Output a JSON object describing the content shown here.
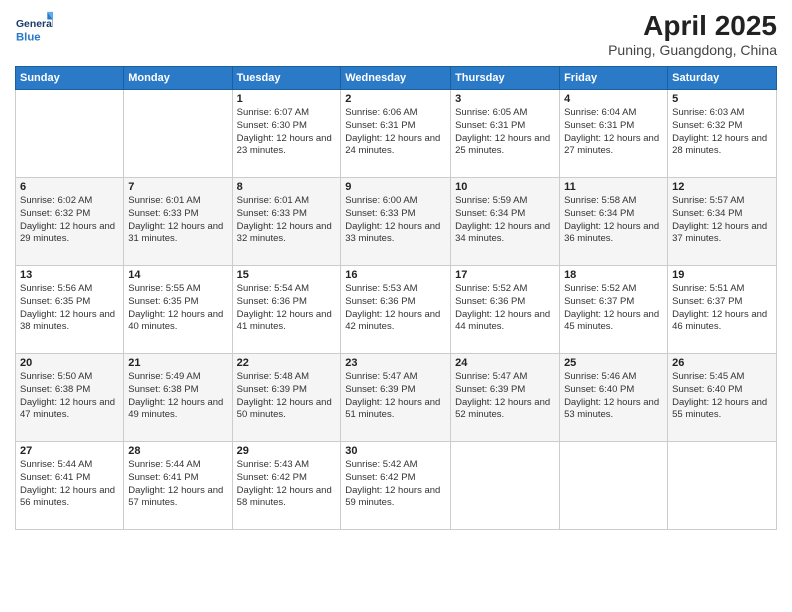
{
  "header": {
    "logo_general": "General",
    "logo_blue": "Blue",
    "title": "April 2025",
    "subtitle": "Puning, Guangdong, China"
  },
  "days_of_week": [
    "Sunday",
    "Monday",
    "Tuesday",
    "Wednesday",
    "Thursday",
    "Friday",
    "Saturday"
  ],
  "weeks": [
    [
      {
        "day": "",
        "info": ""
      },
      {
        "day": "",
        "info": ""
      },
      {
        "day": "1",
        "info": "Sunrise: 6:07 AM\nSunset: 6:30 PM\nDaylight: 12 hours and 23 minutes."
      },
      {
        "day": "2",
        "info": "Sunrise: 6:06 AM\nSunset: 6:31 PM\nDaylight: 12 hours and 24 minutes."
      },
      {
        "day": "3",
        "info": "Sunrise: 6:05 AM\nSunset: 6:31 PM\nDaylight: 12 hours and 25 minutes."
      },
      {
        "day": "4",
        "info": "Sunrise: 6:04 AM\nSunset: 6:31 PM\nDaylight: 12 hours and 27 minutes."
      },
      {
        "day": "5",
        "info": "Sunrise: 6:03 AM\nSunset: 6:32 PM\nDaylight: 12 hours and 28 minutes."
      }
    ],
    [
      {
        "day": "6",
        "info": "Sunrise: 6:02 AM\nSunset: 6:32 PM\nDaylight: 12 hours and 29 minutes."
      },
      {
        "day": "7",
        "info": "Sunrise: 6:01 AM\nSunset: 6:33 PM\nDaylight: 12 hours and 31 minutes."
      },
      {
        "day": "8",
        "info": "Sunrise: 6:01 AM\nSunset: 6:33 PM\nDaylight: 12 hours and 32 minutes."
      },
      {
        "day": "9",
        "info": "Sunrise: 6:00 AM\nSunset: 6:33 PM\nDaylight: 12 hours and 33 minutes."
      },
      {
        "day": "10",
        "info": "Sunrise: 5:59 AM\nSunset: 6:34 PM\nDaylight: 12 hours and 34 minutes."
      },
      {
        "day": "11",
        "info": "Sunrise: 5:58 AM\nSunset: 6:34 PM\nDaylight: 12 hours and 36 minutes."
      },
      {
        "day": "12",
        "info": "Sunrise: 5:57 AM\nSunset: 6:34 PM\nDaylight: 12 hours and 37 minutes."
      }
    ],
    [
      {
        "day": "13",
        "info": "Sunrise: 5:56 AM\nSunset: 6:35 PM\nDaylight: 12 hours and 38 minutes."
      },
      {
        "day": "14",
        "info": "Sunrise: 5:55 AM\nSunset: 6:35 PM\nDaylight: 12 hours and 40 minutes."
      },
      {
        "day": "15",
        "info": "Sunrise: 5:54 AM\nSunset: 6:36 PM\nDaylight: 12 hours and 41 minutes."
      },
      {
        "day": "16",
        "info": "Sunrise: 5:53 AM\nSunset: 6:36 PM\nDaylight: 12 hours and 42 minutes."
      },
      {
        "day": "17",
        "info": "Sunrise: 5:52 AM\nSunset: 6:36 PM\nDaylight: 12 hours and 44 minutes."
      },
      {
        "day": "18",
        "info": "Sunrise: 5:52 AM\nSunset: 6:37 PM\nDaylight: 12 hours and 45 minutes."
      },
      {
        "day": "19",
        "info": "Sunrise: 5:51 AM\nSunset: 6:37 PM\nDaylight: 12 hours and 46 minutes."
      }
    ],
    [
      {
        "day": "20",
        "info": "Sunrise: 5:50 AM\nSunset: 6:38 PM\nDaylight: 12 hours and 47 minutes."
      },
      {
        "day": "21",
        "info": "Sunrise: 5:49 AM\nSunset: 6:38 PM\nDaylight: 12 hours and 49 minutes."
      },
      {
        "day": "22",
        "info": "Sunrise: 5:48 AM\nSunset: 6:39 PM\nDaylight: 12 hours and 50 minutes."
      },
      {
        "day": "23",
        "info": "Sunrise: 5:47 AM\nSunset: 6:39 PM\nDaylight: 12 hours and 51 minutes."
      },
      {
        "day": "24",
        "info": "Sunrise: 5:47 AM\nSunset: 6:39 PM\nDaylight: 12 hours and 52 minutes."
      },
      {
        "day": "25",
        "info": "Sunrise: 5:46 AM\nSunset: 6:40 PM\nDaylight: 12 hours and 53 minutes."
      },
      {
        "day": "26",
        "info": "Sunrise: 5:45 AM\nSunset: 6:40 PM\nDaylight: 12 hours and 55 minutes."
      }
    ],
    [
      {
        "day": "27",
        "info": "Sunrise: 5:44 AM\nSunset: 6:41 PM\nDaylight: 12 hours and 56 minutes."
      },
      {
        "day": "28",
        "info": "Sunrise: 5:44 AM\nSunset: 6:41 PM\nDaylight: 12 hours and 57 minutes."
      },
      {
        "day": "29",
        "info": "Sunrise: 5:43 AM\nSunset: 6:42 PM\nDaylight: 12 hours and 58 minutes."
      },
      {
        "day": "30",
        "info": "Sunrise: 5:42 AM\nSunset: 6:42 PM\nDaylight: 12 hours and 59 minutes."
      },
      {
        "day": "",
        "info": ""
      },
      {
        "day": "",
        "info": ""
      },
      {
        "day": "",
        "info": ""
      }
    ]
  ]
}
